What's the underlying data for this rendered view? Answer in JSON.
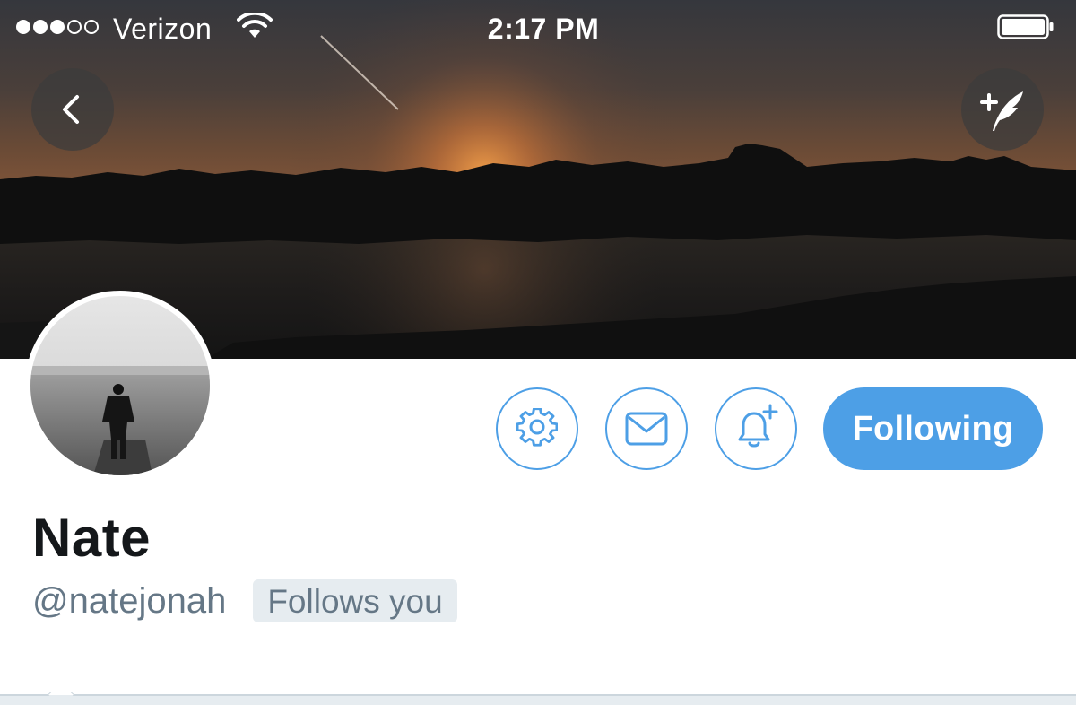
{
  "status_bar": {
    "carrier": "Verizon",
    "time": "2:17 PM",
    "signal_bars_filled": 3,
    "signal_bars_total": 5,
    "icons": [
      "signal-dots-icon",
      "wifi-icon",
      "battery-icon"
    ]
  },
  "header": {
    "back_icon": "chevron-left-icon",
    "compose_icon": "compose-tweet-feather-icon"
  },
  "profile": {
    "display_name": "Nate",
    "handle": "@natejonah",
    "follows_you_badge": "Follows you"
  },
  "actions": {
    "settings_icon": "gear-icon",
    "message_icon": "envelope-icon",
    "notifications_icon": "bell-plus-icon",
    "following_label": "Following"
  },
  "colors": {
    "accent": "#4d9fe6",
    "name_text": "#14171a",
    "secondary_text": "#657786",
    "badge_bg": "#e6ecf0"
  }
}
